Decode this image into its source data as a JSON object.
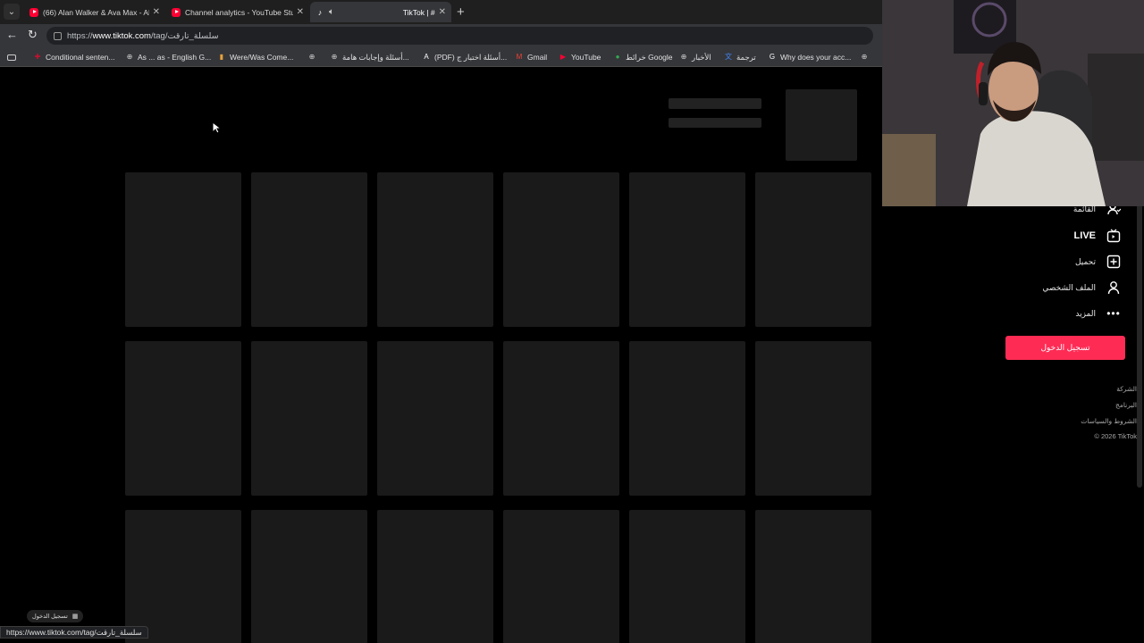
{
  "tabs": [
    {
      "title": "(66) Alan Walker & Ava Max - Alon",
      "icon": "youtube-icon",
      "active": false
    },
    {
      "title": "Channel analytics - YouTube Studi",
      "icon": "youtube-icon",
      "active": false
    },
    {
      "title": "TikTok | #",
      "icon": "tiktok-icon",
      "active": true
    }
  ],
  "address": {
    "protocol": "https://",
    "host": "www.tiktok.com",
    "path": "/tag/سلسلة_تارقت"
  },
  "bookmarks": [
    {
      "label": "Conditional senten...",
      "icon": "uk-flag-icon",
      "color": "#c8102e"
    },
    {
      "label": "As ... as - English G...",
      "icon": "globe-icon",
      "color": ""
    },
    {
      "label": "Were/Was Come...",
      "icon": "folder-icon",
      "color": "#e6a23c"
    },
    {
      "label": "",
      "icon": "globe-icon",
      "color": ""
    },
    {
      "label": "أسئلة وإجابات هامة...",
      "icon": "globe-icon",
      "color": ""
    },
    {
      "label": "(PDF) أسئلة اختبار ج...",
      "icon": "academia-icon",
      "color": "#ffffff"
    },
    {
      "label": "Gmail",
      "icon": "gmail-icon",
      "color": "#ea4335"
    },
    {
      "label": "YouTube",
      "icon": "youtube-icon",
      "color": "#ff0033"
    },
    {
      "label": "خرائط Google",
      "icon": "maps-icon",
      "color": "#34a853"
    },
    {
      "label": "الأخبار",
      "icon": "globe-icon",
      "color": ""
    },
    {
      "label": "ترجمة",
      "icon": "translate-icon",
      "color": "#4285f4"
    },
    {
      "label": "Why does your acc...",
      "icon": "google-icon",
      "color": "#ffffff"
    },
    {
      "label": "",
      "icon": "globe-icon",
      "color": ""
    }
  ],
  "sidebar": {
    "items": [
      {
        "label": "القائمة",
        "icon": "following-icon"
      },
      {
        "label": "LIVE",
        "icon": "live-icon"
      },
      {
        "label": "تحميل",
        "icon": "upload-icon"
      },
      {
        "label": "الملف الشخصي",
        "icon": "profile-icon"
      },
      {
        "label": "المزيد",
        "icon": "more-icon"
      }
    ],
    "login_button": "تسجيل الدخول",
    "accent": "#fe2c55",
    "footer": [
      "الشركة",
      "البرنامج",
      "الشروط والسياسات",
      "© 2026 TikTok"
    ]
  },
  "status": {
    "hover_url": "https://www.tiktok.com/tag/سلسلة_تارقت",
    "floating_login": "تسجيل الدخول"
  }
}
